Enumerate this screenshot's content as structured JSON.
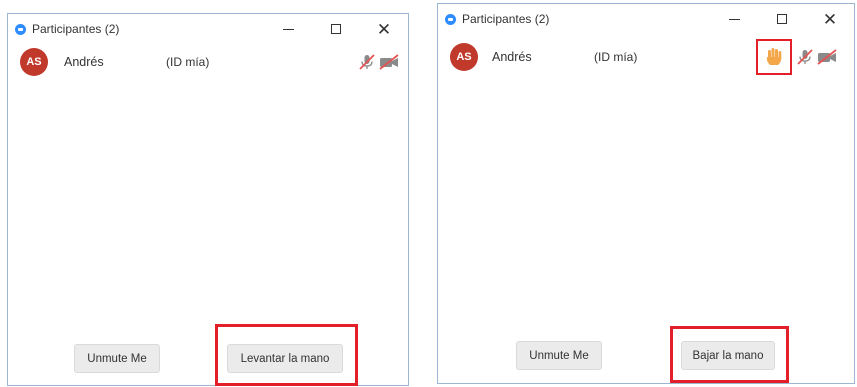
{
  "left_window": {
    "title": "Participantes (2)",
    "participant": {
      "initials": "AS",
      "name": "Andrés",
      "id_label": "(ID mía)"
    },
    "buttons": {
      "unmute": "Unmute Me",
      "raise_hand": "Levantar la mano"
    },
    "hand_raised": false
  },
  "right_window": {
    "title": "Participantes (2)",
    "participant": {
      "initials": "AS",
      "name": "Andrés",
      "id_label": "(ID mía)"
    },
    "buttons": {
      "unmute": "Unmute Me",
      "lower_hand": "Bajar la mano"
    },
    "hand_raised": true
  },
  "colors": {
    "avatar": "#c0392b",
    "highlight": "#e3202a",
    "zoom_blue": "#2d8cff",
    "hand": "#f3a64a",
    "muted_red": "#e55353"
  },
  "icons": {
    "app": "zoom-logo-icon",
    "minimize": "minimize-icon",
    "maximize": "maximize-icon",
    "close": "close-icon",
    "mic_muted": "mic-muted-icon",
    "video_off": "video-off-icon",
    "hand": "raised-hand-icon"
  }
}
